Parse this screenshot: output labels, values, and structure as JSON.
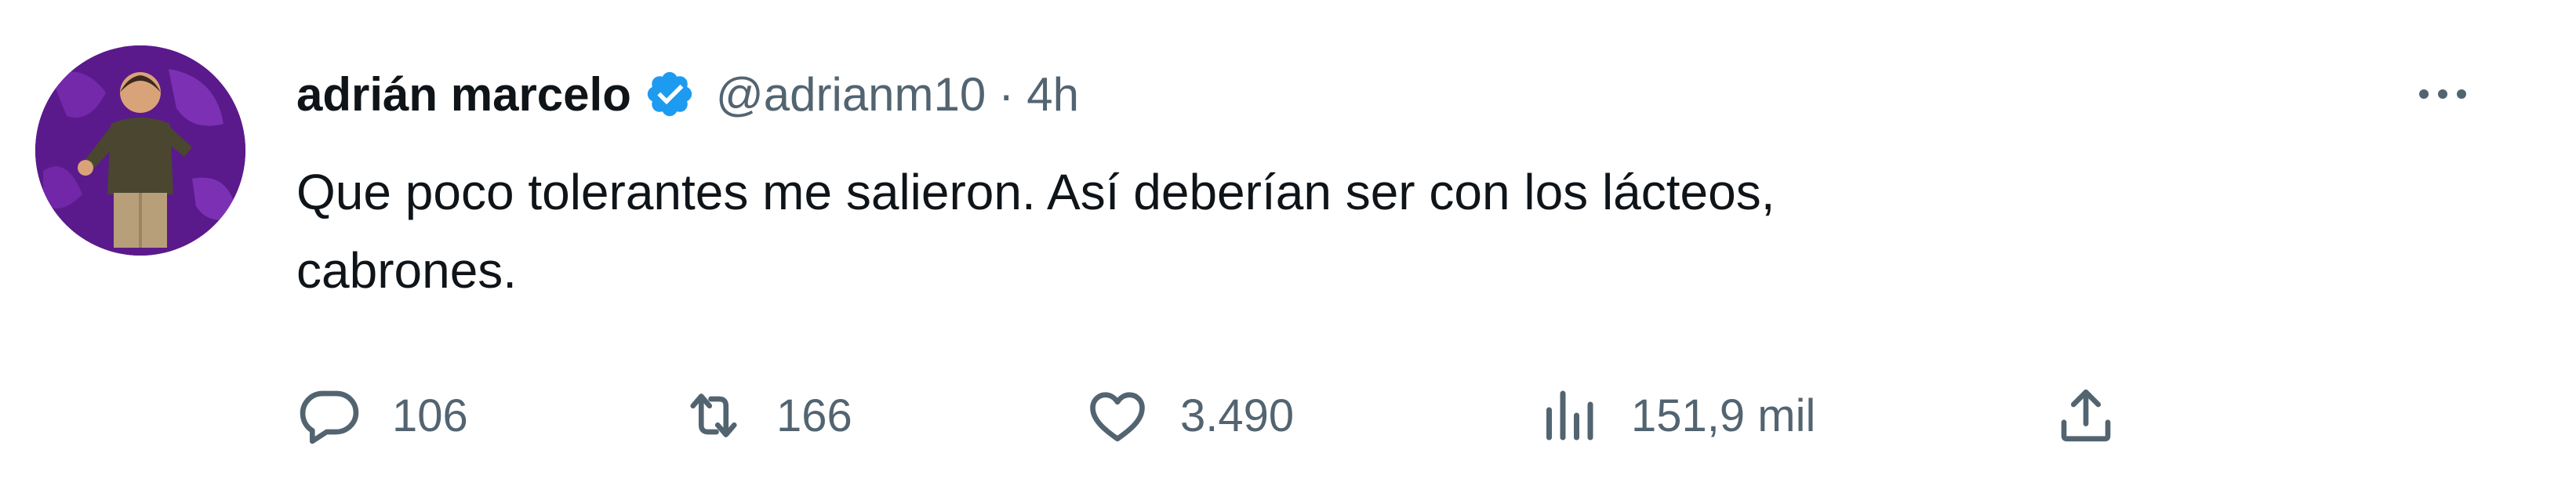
{
  "tweet": {
    "display_name": "adrián marcelo",
    "handle": "@adrianm10",
    "separator": "·",
    "time": "4h",
    "text_line1": "Que poco tolerantes me salieron. Así deberían ser con los lácteos,",
    "text_line2": "cabrones.",
    "avatar": "profile-photo",
    "verified_icon": "verified-badge-icon",
    "more_icon": "more-options-icon"
  },
  "actions": {
    "reply": {
      "icon": "reply-icon",
      "count": "106"
    },
    "retweet": {
      "icon": "retweet-icon",
      "count": "166"
    },
    "like": {
      "icon": "heart-icon",
      "count": "3.490"
    },
    "views": {
      "icon": "views-icon",
      "count": "151,9 mil"
    },
    "share": {
      "icon": "share-icon"
    }
  },
  "colors": {
    "text": "#0f1419",
    "secondary": "#536471",
    "verified": "#1d9bf0",
    "avatar_bg": "#5a1a8c"
  }
}
